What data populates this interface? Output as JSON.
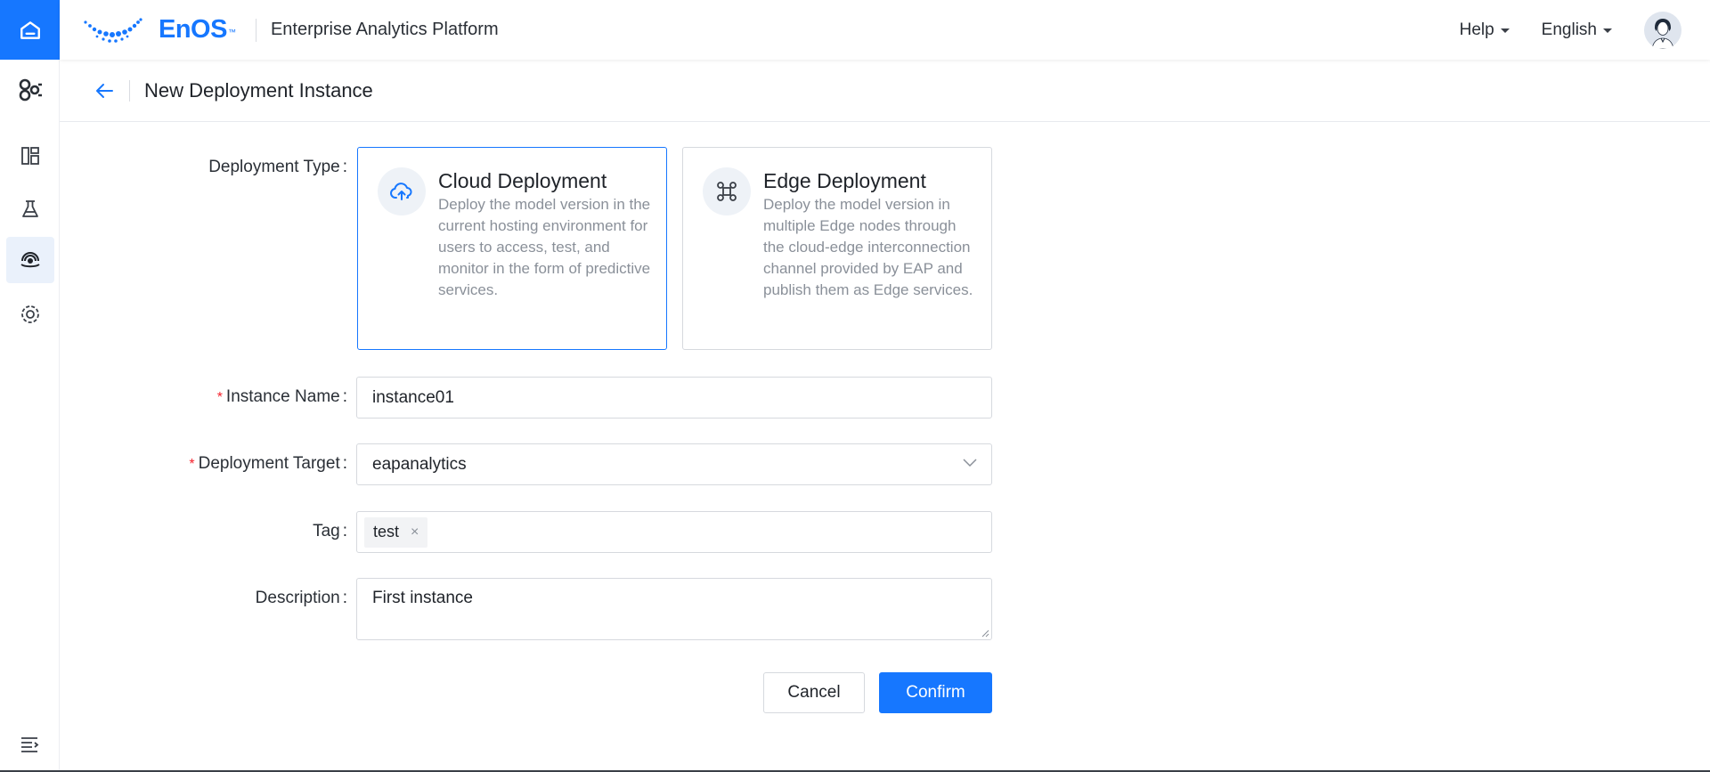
{
  "brand": {
    "logo_text": "EnOS",
    "logo_tm": "™",
    "platform_name": "Enterprise Analytics Platform"
  },
  "header": {
    "help_label": "Help",
    "language_label": "English"
  },
  "sidebar": {
    "items": [
      {
        "icon": "home-icon"
      },
      {
        "icon": "model-network-icon"
      },
      {
        "icon": "dashboard-layout-icon"
      },
      {
        "icon": "flask-icon"
      },
      {
        "icon": "deployment-icon",
        "active": true
      },
      {
        "icon": "monitor-settings-icon"
      }
    ],
    "collapse_icon": "collapse-menu-icon"
  },
  "page": {
    "title": "New Deployment Instance"
  },
  "form": {
    "deployment_type": {
      "label": "Deployment Type",
      "options": [
        {
          "title": "Cloud Deployment",
          "description": "Deploy the model version in the current hosting environment for users to access, test, and monitor in the form of predictive services.",
          "icon": "cloud-upload-icon",
          "selected": true
        },
        {
          "title": "Edge Deployment",
          "description": "Deploy the model version in multiple Edge nodes through the cloud-edge interconnection channel provided by EAP and publish them as Edge services.",
          "icon": "edge-nodes-icon",
          "selected": false
        }
      ]
    },
    "instance_name": {
      "label": "Instance Name",
      "value": "instance01",
      "required": true
    },
    "deployment_target": {
      "label": "Deployment Target",
      "value": "eapanalytics",
      "required": true
    },
    "tag": {
      "label": "Tag",
      "tags": [
        "test"
      ]
    },
    "description": {
      "label": "Description",
      "value": "First instance"
    }
  },
  "actions": {
    "cancel_label": "Cancel",
    "confirm_label": "Confirm"
  },
  "colors": {
    "primary": "#1677ff",
    "required": "#f5222d",
    "border": "#d6d9de"
  }
}
